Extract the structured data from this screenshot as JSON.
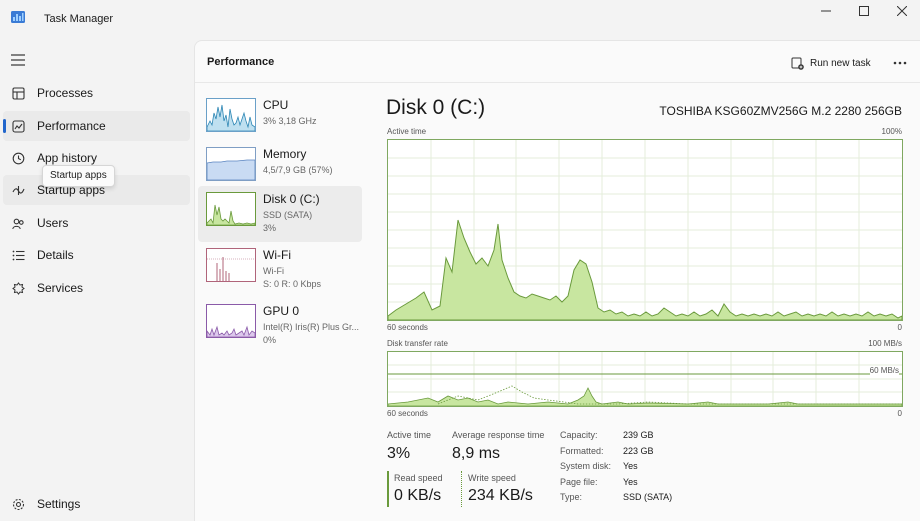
{
  "window": {
    "title": "Task Manager",
    "controls": [
      "minimize-icon",
      "maximize-icon",
      "close-icon"
    ]
  },
  "nav": {
    "items": [
      {
        "label": "Processes",
        "icon": "processes-icon"
      },
      {
        "label": "Performance",
        "icon": "performance-icon"
      },
      {
        "label": "App history",
        "icon": "history-icon"
      },
      {
        "label": "Startup apps",
        "icon": "startup-icon"
      },
      {
        "label": "Users",
        "icon": "users-icon"
      },
      {
        "label": "Details",
        "icon": "details-icon"
      },
      {
        "label": "Services",
        "icon": "services-icon"
      }
    ],
    "settings_label": "Settings",
    "tooltip": "Startup apps",
    "accent_color": "#2266cc"
  },
  "header": {
    "title": "Performance",
    "run_new_task": "Run new task"
  },
  "resources": [
    {
      "name": "CPU",
      "line1": "3% 3,18 GHz",
      "line2": ""
    },
    {
      "name": "Memory",
      "line1": "4,5/7,9 GB (57%)",
      "line2": ""
    },
    {
      "name": "Disk 0 (C:)",
      "line1": "SSD (SATA)",
      "line2": "3%"
    },
    {
      "name": "Wi-Fi",
      "line1": "Wi-Fi",
      "line2": "S: 0 R: 0 Kbps"
    },
    {
      "name": "GPU 0",
      "line1": "Intel(R) Iris(R) Plus Gr...",
      "line2": "0%"
    }
  ],
  "detail": {
    "title": "Disk 0 (C:)",
    "model": "TOSHIBA KSG60ZMV256G M.2 2280 256GB",
    "active_graph": {
      "label": "Active time",
      "max_label": "100%",
      "left_label": "60 seconds",
      "right_label": "0"
    },
    "transfer_graph": {
      "label": "Disk transfer rate",
      "max_label": "100 MB/s",
      "ref_label": "60 MB/s",
      "left_label": "60 seconds",
      "right_label": "0"
    },
    "stats": {
      "active_time_label": "Active time",
      "active_time_value": "3%",
      "avg_response_label": "Average response time",
      "avg_response_value": "8,9 ms",
      "read_speed_label": "Read speed",
      "read_speed_value": "0 KB/s",
      "write_speed_label": "Write speed",
      "write_speed_value": "234 KB/s"
    },
    "properties": [
      {
        "label": "Capacity:",
        "value": "239 GB"
      },
      {
        "label": "Formatted:",
        "value": "223 GB"
      },
      {
        "label": "System disk:",
        "value": "Yes"
      },
      {
        "label": "Page file:",
        "value": "Yes"
      },
      {
        "label": "Type:",
        "value": "SSD (SATA)"
      }
    ],
    "graph_color": "#6a9a3c",
    "graph_fill": "#c8e6a0"
  }
}
